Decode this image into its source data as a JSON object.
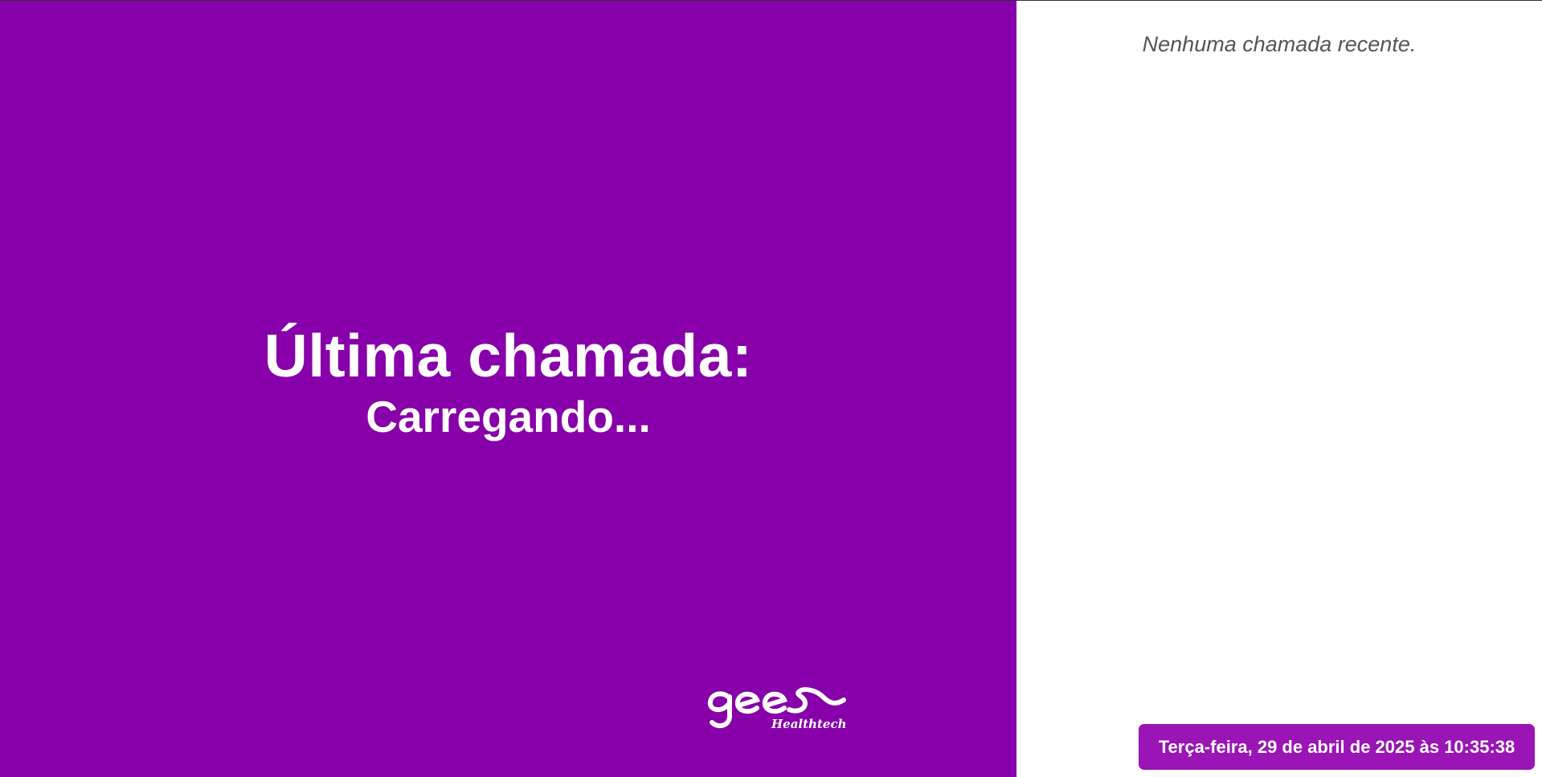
{
  "colors": {
    "main_background": "#8700a9",
    "side_background": "#ffffff",
    "badge_background": "#9a14b6",
    "primary_text": "#ffffff",
    "muted_text": "#555555"
  },
  "main": {
    "heading": "Última chamada:",
    "value": "Carregando..."
  },
  "logo": {
    "icon": "gees-healthtech-logo",
    "wordmark": "gees",
    "tagline": "Healthtech"
  },
  "recent_calls": {
    "empty_message": "Nenhuma chamada recente.",
    "items": []
  },
  "clock": {
    "text": "Terça-feira, 29 de abril de 2025 às 10:35:38"
  }
}
